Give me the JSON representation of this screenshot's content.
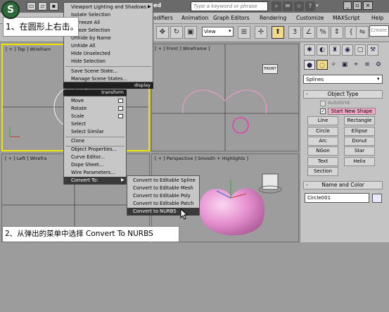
{
  "app": {
    "logo_glyph": "S",
    "title_partial": "ed"
  },
  "search": {
    "placeholder": "Type a keyword or phrase"
  },
  "menubar": {
    "items": [
      "odifiers",
      "Animation",
      "Graph Editors",
      "Rendering",
      "Customize",
      "MAXScript",
      "Help"
    ]
  },
  "toolbar": {
    "view_select": "View",
    "create_input": "Create"
  },
  "viewports": {
    "top": "[ + ] Top  ] Wirefram",
    "front": "[ + ] Front ] Wireframe ]",
    "left": "[ + ] Left ] Wirefra",
    "perspective": "[ + ] Perspective ] Smooth + Highlights ]",
    "front_cube_label": "FRONT"
  },
  "command_panel": {
    "category_select": "Splines",
    "object_type_title": "Object Type",
    "autogrid_label": "AutoGrid",
    "start_new_shape_label": "Start New Shape",
    "buttons": [
      "Line",
      "Rectangle",
      "Circle",
      "Ellipse",
      "Arc",
      "Donut",
      "NGon",
      "Star",
      "Text",
      "Helix",
      "Section"
    ],
    "name_color_title": "Name and Color",
    "name_value": "Circle001"
  },
  "quad_menu": {
    "display_items": [
      "Viewport Lighting and Shadows",
      "Isolate Selection",
      "Unfreeze All",
      "Freeze Selection",
      "Unhide by Name",
      "Unhide All",
      "Hide Unselected",
      "Hide Selection",
      "Save Scene State...",
      "Manage Scene States..."
    ],
    "display_label": "display",
    "transform_label": "transform",
    "transform_items": [
      "Move",
      "Rotate",
      "Scale",
      "Select",
      "Select Similar",
      "Clone",
      "Object Properties...",
      "Curve Editor...",
      "Dope Sheet...",
      "Wire Parameters...",
      "Convert To:"
    ],
    "convert_items": [
      "Convert to Editable Spline",
      "Convert to Editable Mesh",
      "Convert to Editable Poly",
      "Convert to Editable Patch",
      "Convert to NURBS"
    ]
  },
  "callouts": {
    "step1": "1、在圆形上右击。",
    "step2": "2、从弹出的菜单中选择 Convert To NURBS"
  },
  "colors": {
    "active_viewport_border": "#f1e400",
    "start_new_shape_bg": "#f7a8c9",
    "spline_color": "#e89bc5",
    "apple_color": "#e58fcf"
  }
}
